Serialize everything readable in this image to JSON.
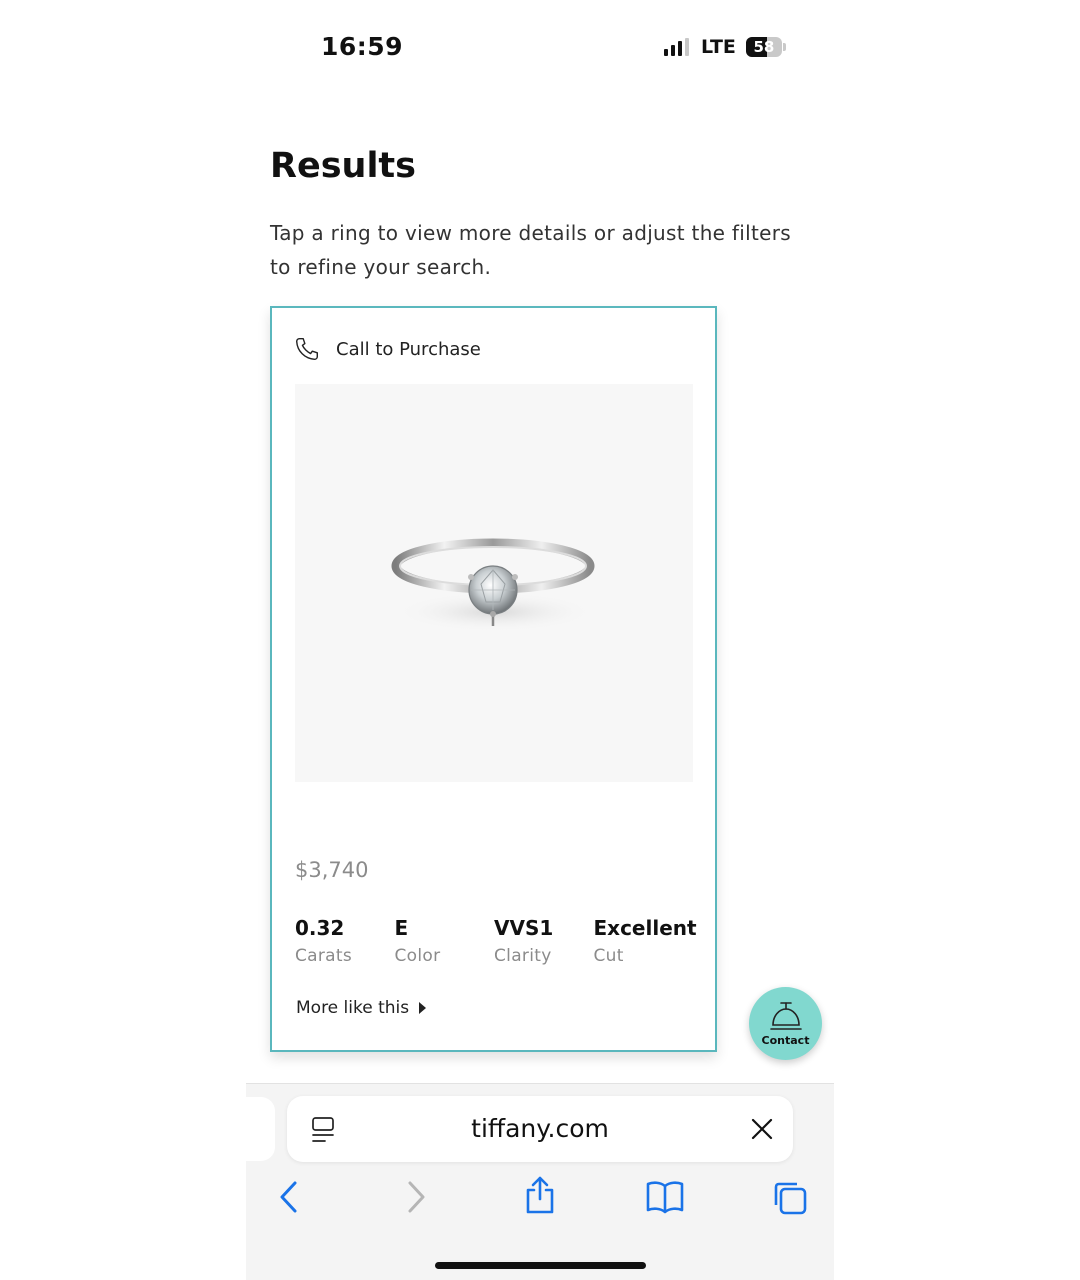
{
  "status_bar": {
    "time": "16:59",
    "network": "LTE",
    "battery": "58",
    "signal_bars_active": 3,
    "signal_bars_total": 4,
    "battery_level": 0.58
  },
  "page": {
    "title": "Results",
    "description": "Tap a ring to view more details or adjust the filters to refine your search."
  },
  "product_card": {
    "call_label": "Call to Purchase",
    "price": "$3,740",
    "specs": [
      {
        "value": "0.32",
        "label": "Carats"
      },
      {
        "value": "E",
        "label": "Color"
      },
      {
        "value": "VVS1",
        "label": "Clarity"
      },
      {
        "value": "Excellent",
        "label": "Cut"
      }
    ],
    "more_label": "More like this",
    "accent_color": "#5ab7bd"
  },
  "contact_button": {
    "label": "Contact",
    "color": "#81d8cf",
    "icon": "service-bell-icon"
  },
  "browser": {
    "url": "tiffany.com",
    "icons": [
      "reader-icon",
      "close-icon",
      "back-icon",
      "forward-icon",
      "share-icon",
      "bookmarks-icon",
      "tabs-icon"
    ],
    "tint_color": "#1a73e8"
  }
}
